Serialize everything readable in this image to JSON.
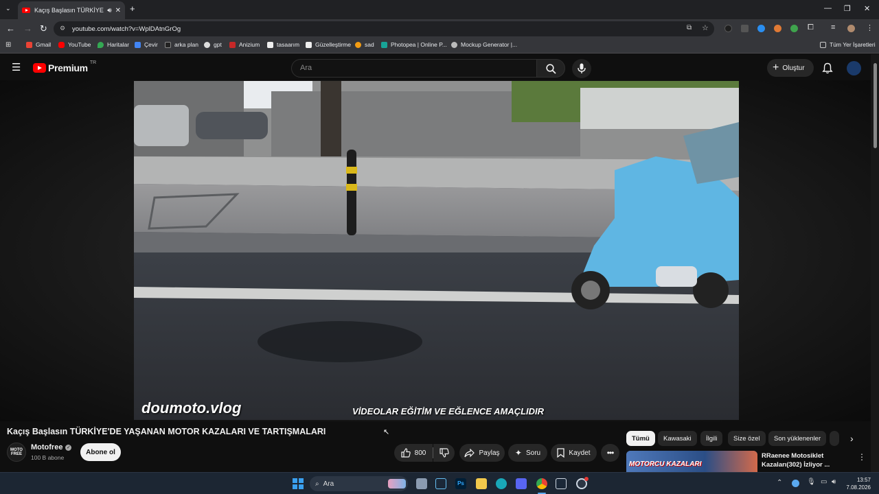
{
  "browser": {
    "tab_title": "Kaçış Başlasın TÜRKİYE'DE YAŞANAN MOTOR KAZALARI VE TARTIŞMALARI",
    "url": "youtube.com/watch?v=WplDAtnGrOg",
    "bookmarks": [
      "Gmail",
      "YouTube",
      "Haritalar",
      "Çevir",
      "arka plan",
      "gpt",
      "Anizium",
      "tasaarım",
      "Güzelleştirme",
      "sad",
      "Photopea | Online P...",
      "Mockup Generator |..."
    ],
    "all_bookmarks": "Tüm Yer İşaretleri"
  },
  "youtube": {
    "logo_text": "Premium",
    "logo_badge": "TR",
    "search_placeholder": "Ara",
    "create_label": "Oluştur"
  },
  "video": {
    "watermark_left": "doumoto.vlog",
    "watermark_center": "VİDEOLAR EĞİTİM VE EĞLENCE AMAÇLIDIR",
    "title": "Kaçış Başlasın TÜRKİYE'DE YAŞANAN MOTOR KAZALARI VE TARTIŞMALARI",
    "channel": "Motofree",
    "avatar_text": "MOTO FREE",
    "subscribers": "100 B abone",
    "subscribe_label": "Abone ol",
    "likes": "800",
    "share_label": "Paylaş",
    "ask_label": "Soru",
    "save_label": "Kaydet"
  },
  "chips": [
    "Tümü",
    "Kawasaki",
    "İlgili",
    "Size özel",
    "Son yüklenenler"
  ],
  "recommendation": {
    "thumb_text": "MOTORCU KAZALARI",
    "title_line1": "RRaenee Motosiklet",
    "title_line2": "Kazaları(302) İzliyor ..."
  },
  "taskbar": {
    "search_label": "Ara",
    "time": "13:57",
    "date": "7.08.2026"
  }
}
